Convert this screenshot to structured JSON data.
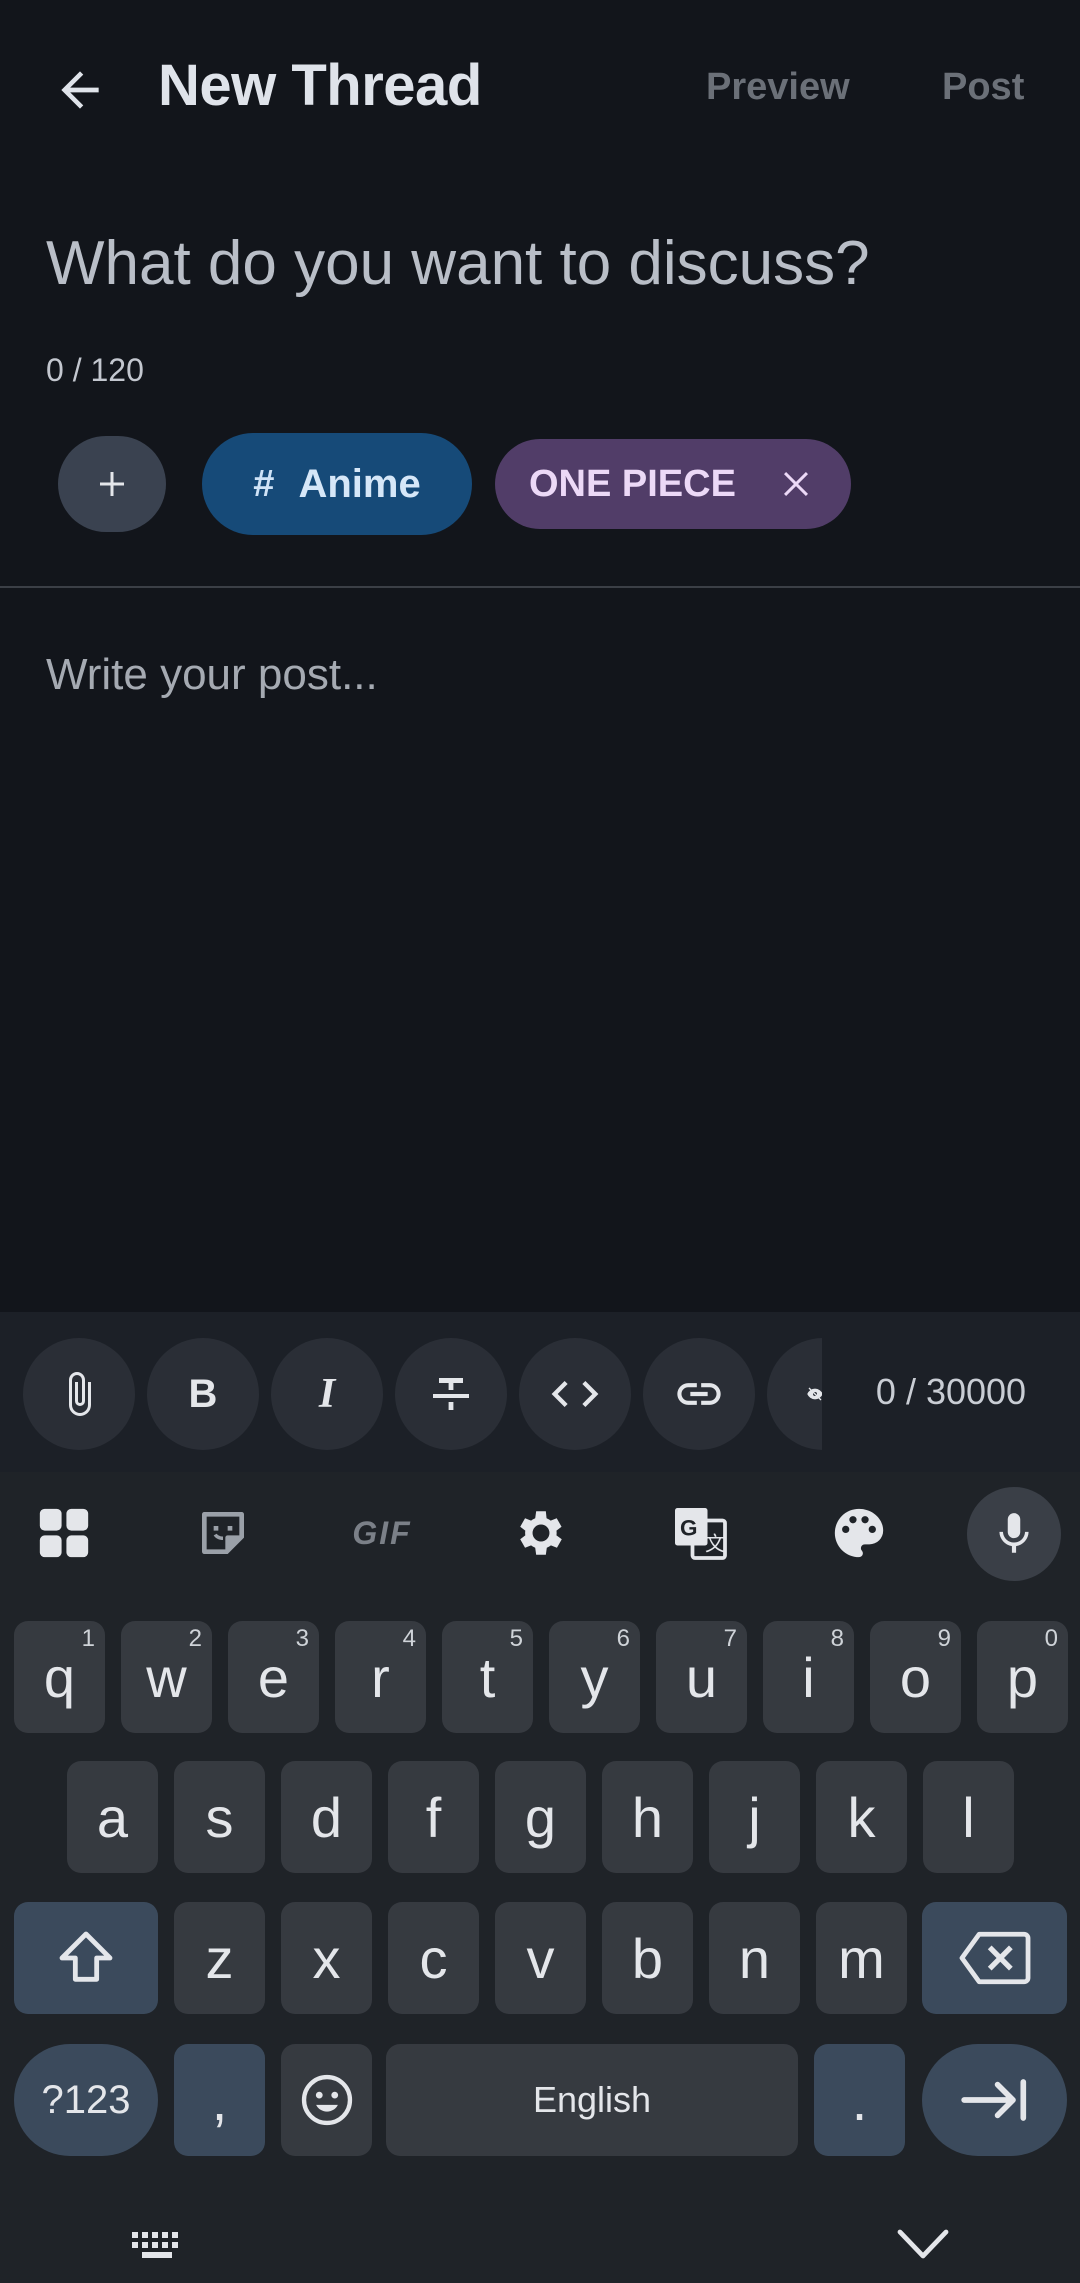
{
  "header": {
    "title": "New Thread",
    "preview": "Preview",
    "post": "Post"
  },
  "subject": {
    "placeholder": "What do you want to discuss?",
    "count": "0 / 120"
  },
  "chips": {
    "anime": "Anime",
    "tag": "ONE PIECE"
  },
  "body": {
    "placeholder": "Write your post..."
  },
  "format": {
    "count": "0 / 30000"
  },
  "keyboard": {
    "row1": [
      {
        "k": "q",
        "h": "1"
      },
      {
        "k": "w",
        "h": "2"
      },
      {
        "k": "e",
        "h": "3"
      },
      {
        "k": "r",
        "h": "4"
      },
      {
        "k": "t",
        "h": "5"
      },
      {
        "k": "y",
        "h": "6"
      },
      {
        "k": "u",
        "h": "7"
      },
      {
        "k": "i",
        "h": "8"
      },
      {
        "k": "o",
        "h": "9"
      },
      {
        "k": "p",
        "h": "0"
      }
    ],
    "row2": [
      "a",
      "s",
      "d",
      "f",
      "g",
      "h",
      "j",
      "k",
      "l"
    ],
    "row3": [
      "z",
      "x",
      "c",
      "v",
      "b",
      "n",
      "m"
    ],
    "sym": "?123",
    "comma": ",",
    "space": "English",
    "period": "."
  }
}
